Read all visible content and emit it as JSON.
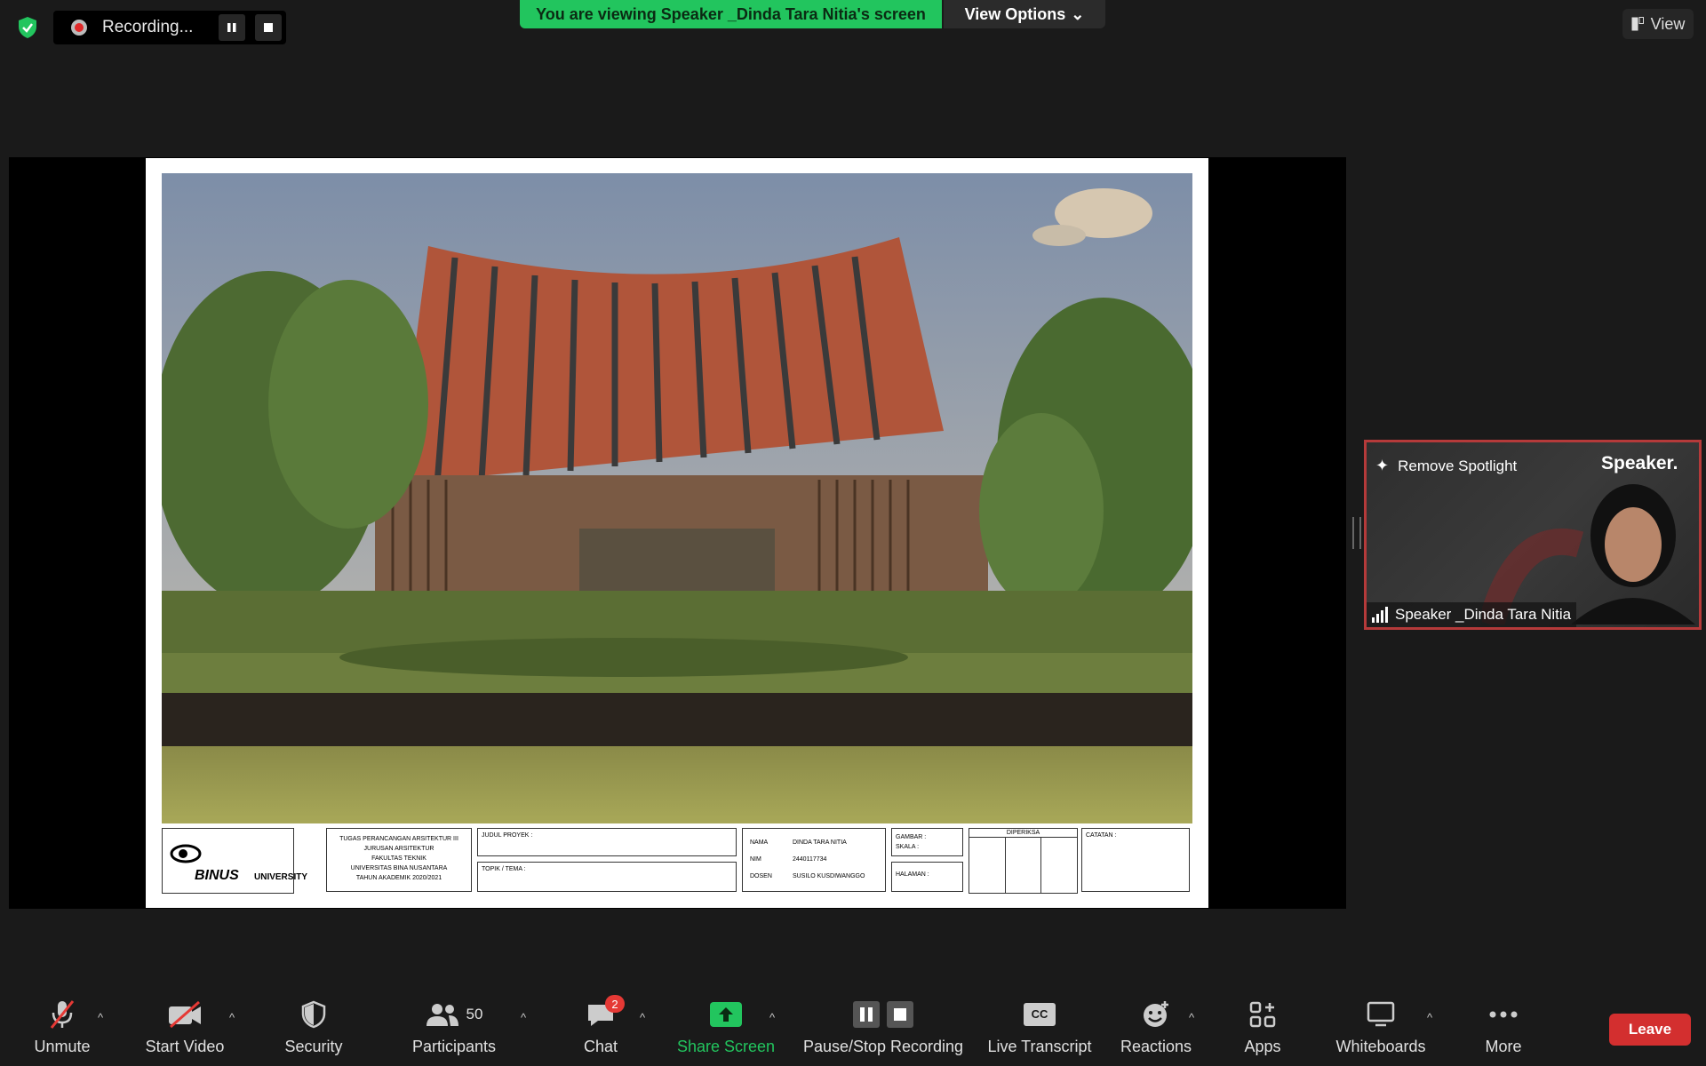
{
  "recording": {
    "label": "Recording..."
  },
  "banner": {
    "text": "You are viewing Speaker _Dinda Tara Nitia's screen"
  },
  "view_options": {
    "label": "View Options"
  },
  "view_button": {
    "label": "View"
  },
  "shared_screen": {
    "title_block": {
      "logo_text": "BINUS",
      "logo_suffix": "UNIVERSITY",
      "course": [
        "TUGAS PERANCANGAN ARSITEKTUR III",
        "JURUSAN ARSITEKTUR",
        "FAKULTAS TEKNIK",
        "UNIVERSITAS BINA NUSANTARA",
        "TAHUN AKADEMIK 2020/2021"
      ],
      "judul_label": "JUDUL PROYEK :",
      "topik_label": "TOPIK / TEMA :",
      "nama_label": "NAMA",
      "nama_value": "DINDA TARA NITIA",
      "nim_label": "NIM",
      "nim_value": "2440117734",
      "dosen_label": "DOSEN",
      "dosen_value": "SUSILO KUSDIWANGGO",
      "gambar_label": "GAMBAR :",
      "skala_label": "SKALA :",
      "halaman_label": "HALAMAN :",
      "diperiksa_label": "DIPERIKSA",
      "catatan_label": "CATATAN :"
    }
  },
  "speaker_tile": {
    "spotlight_label": "Remove Spotlight",
    "logo": "Speaker.",
    "name": "Speaker _Dinda Tara Nitia"
  },
  "toolbar": {
    "unmute": "Unmute",
    "start_video": "Start Video",
    "security": "Security",
    "participants": "Participants",
    "participants_count": "50",
    "chat": "Chat",
    "chat_badge": "2",
    "share_screen": "Share Screen",
    "pause_stop": "Pause/Stop Recording",
    "live_transcript": "Live Transcript",
    "cc": "CC",
    "reactions": "Reactions",
    "apps": "Apps",
    "whiteboards": "Whiteboards",
    "more": "More",
    "leave": "Leave"
  },
  "colors": {
    "accent_green": "#22c55e",
    "leave_red": "#d32f2f",
    "spotlight_border": "#b53a3a"
  }
}
